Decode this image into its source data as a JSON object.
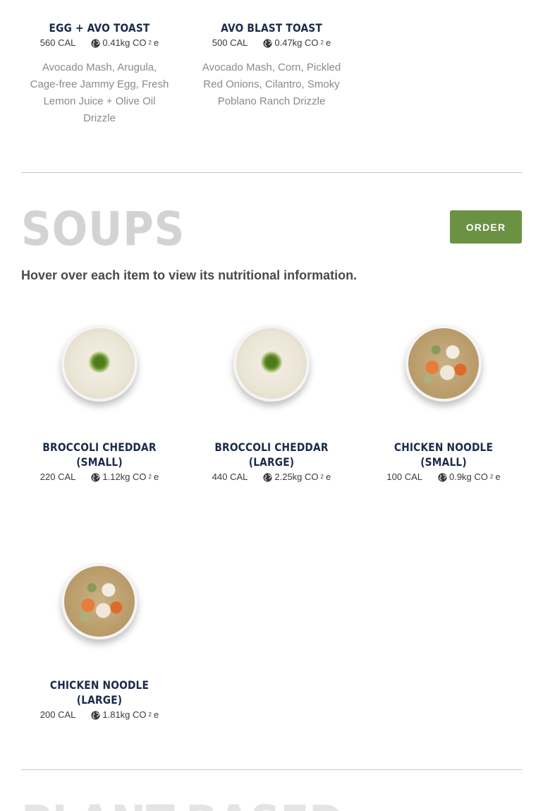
{
  "toasts": [
    {
      "name": "EGG + AVO TOAST",
      "cal": "560 CAL",
      "co2_value": "0.41kg CO",
      "co2_sub": "2",
      "co2_suffix": "e",
      "description": "Avocado Mash, Arugula, Cage-free Jammy Egg, Fresh Lemon Juice + Olive Oil Drizzle"
    },
    {
      "name": "AVO BLAST TOAST",
      "cal": "500 CAL",
      "co2_value": "0.47kg CO",
      "co2_sub": "2",
      "co2_suffix": "e",
      "description": "Avocado Mash, Corn, Pickled Red Onions, Cilantro, Smoky Poblano Ranch Drizzle"
    }
  ],
  "soups_section": {
    "title": "SOUPS",
    "order_label": "ORDER",
    "hint": "Hover over each item to view its nutritional information.",
    "items": [
      {
        "name": "BROCCOLI CHEDDAR\n(SMALL)",
        "cal": "220 CAL",
        "co2_value": "1.12kg CO",
        "co2_sub": "2",
        "co2_suffix": "e",
        "image": "broccoli-cheddar-soup"
      },
      {
        "name": "BROCCOLI CHEDDAR\n(LARGE)",
        "cal": "440 CAL",
        "co2_value": "2.25kg CO",
        "co2_sub": "2",
        "co2_suffix": "e",
        "image": "broccoli-cheddar-soup"
      },
      {
        "name": "CHICKEN NOODLE\n(SMALL)",
        "cal": "100 CAL",
        "co2_value": "0.9kg CO",
        "co2_sub": "2",
        "co2_suffix": "e",
        "image": "chicken-noodle-soup"
      },
      {
        "name": "CHICKEN NOODLE\n(LARGE)",
        "cal": "200 CAL",
        "co2_value": "1.81kg CO",
        "co2_sub": "2",
        "co2_suffix": "e",
        "image": "chicken-noodle-soup"
      }
    ]
  },
  "next_section": {
    "title": "PLANT-BASED"
  },
  "colors": {
    "accent": "#6b9143",
    "heading": "#1b2b4a",
    "section_title": "#d3d3d3"
  },
  "icons": {
    "co2": "globe-icon"
  }
}
